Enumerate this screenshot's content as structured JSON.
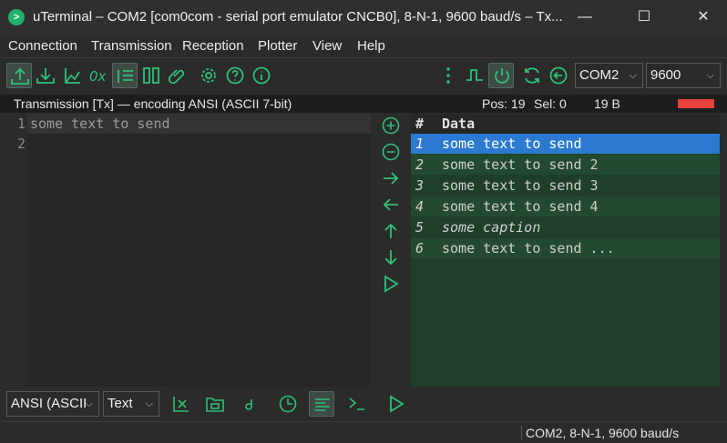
{
  "window": {
    "title": "uTerminal – COM2   [com0com - serial port emulator CNCB0], 8-N-1, 9600 baud/s – Tx...",
    "app_icon": "terminal-icon",
    "minimize": "—",
    "maximize": "☐",
    "close": "✕"
  },
  "menu": [
    "Connection",
    "Transmission",
    "Reception",
    "Plotter",
    "View",
    "Help"
  ],
  "toolbar": {
    "port": "COM2",
    "baud": "9600",
    "accent": "#2fc07a"
  },
  "status_line": {
    "mode": "Transmission [Tx] — encoding ANSI (ASCII 7-bit)",
    "pos": "Pos: 19",
    "sel": "Sel: 0",
    "size": "19 B",
    "indicator_color": "#e8413c"
  },
  "editor": {
    "lines": [
      {
        "no": "1",
        "text": "some text to send"
      },
      {
        "no": "2",
        "text": ""
      }
    ]
  },
  "list": {
    "headers": [
      "#",
      "Data"
    ],
    "rows": [
      {
        "num": "1",
        "text": "some text to send"
      },
      {
        "num": "2",
        "text": "some text to send 2"
      },
      {
        "num": "3",
        "text": "some text to send 3"
      },
      {
        "num": "4",
        "text": "some text to send 4"
      },
      {
        "num": "5",
        "text": "some caption"
      },
      {
        "num": "6",
        "text": "some text to send ..."
      }
    ]
  },
  "bottom": {
    "encoding": "ANSI (ASCII",
    "format": "Text"
  },
  "statusbar": {
    "text": "COM2, 8-N-1, 9600 baud/s"
  }
}
